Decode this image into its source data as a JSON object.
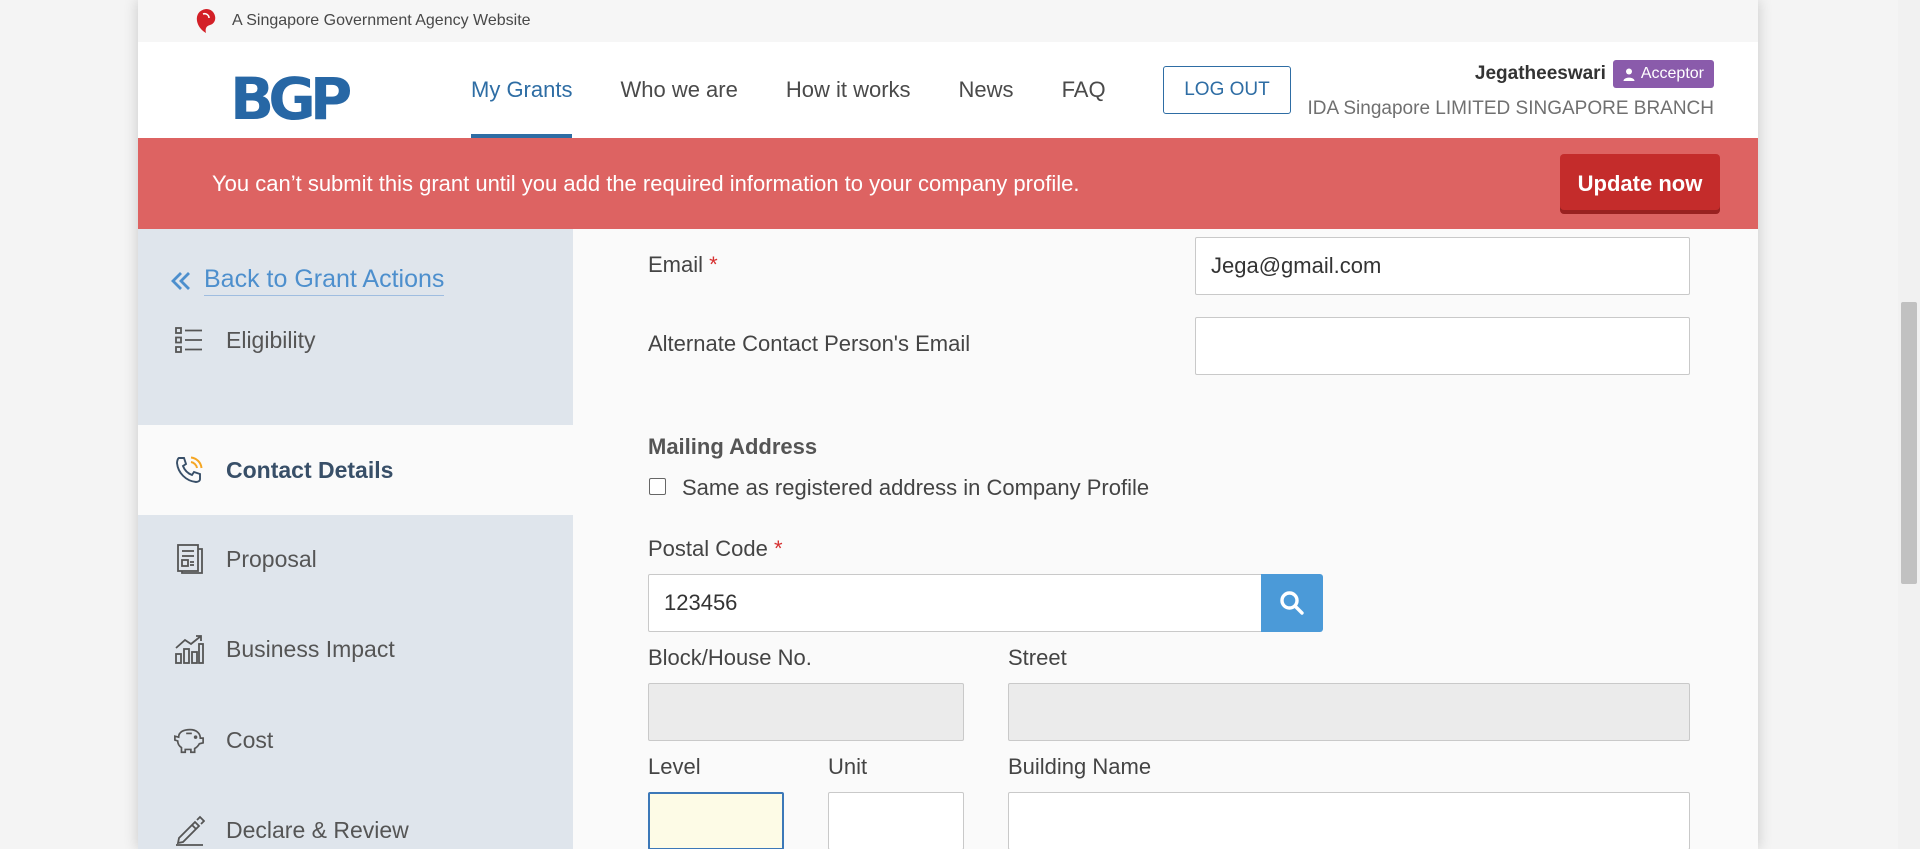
{
  "gov_bar": {
    "text": "A Singapore Government Agency Website"
  },
  "header": {
    "logo": "BGP",
    "nav": [
      {
        "label": "My Grants",
        "active": true
      },
      {
        "label": "Who we are",
        "active": false
      },
      {
        "label": "How it works",
        "active": false
      },
      {
        "label": "News",
        "active": false
      },
      {
        "label": "FAQ",
        "active": false
      }
    ],
    "logout_label": "LOG OUT",
    "user_name": "Jegatheeswari",
    "role_label": "Acceptor",
    "company": "IDA Singapore LIMITED SINGAPORE BRANCH"
  },
  "alert": {
    "message": "You can’t submit this grant until you add the required information to your company profile.",
    "button_label": "Update now"
  },
  "sidebar": {
    "back_label": "Back to Grant Actions",
    "items": [
      {
        "label": "Eligibility",
        "icon": "list-icon",
        "active": false
      },
      {
        "label": "Contact Details",
        "icon": "phone-icon",
        "active": true
      },
      {
        "label": "Proposal",
        "icon": "document-icon",
        "active": false
      },
      {
        "label": "Business Impact",
        "icon": "chart-icon",
        "active": false
      },
      {
        "label": "Cost",
        "icon": "piggy-bank-icon",
        "active": false
      },
      {
        "label": "Declare & Review",
        "icon": "pen-icon",
        "active": false
      }
    ]
  },
  "form": {
    "email_label": "Email",
    "required_mark": "*",
    "email_value": "Jega@gmail.com",
    "alt_email_label": "Alternate Contact Person's Email",
    "alt_email_value": "",
    "mailing_title": "Mailing Address",
    "same_address_label": "Same as registered address in Company Profile",
    "same_address_checked": false,
    "postal_label": "Postal Code",
    "postal_value": "123456",
    "block_label": "Block/House No.",
    "street_label": "Street",
    "level_label": "Level",
    "unit_label": "Unit",
    "building_label": "Building Name"
  },
  "colors": {
    "brand_blue": "#2e6da4",
    "alert_red": "#dd6362",
    "alert_button": "#c42c2b",
    "role_purple": "#8a5bab",
    "search_button": "#4b9ad8",
    "sidebar_bg": "#dfe5ec"
  }
}
